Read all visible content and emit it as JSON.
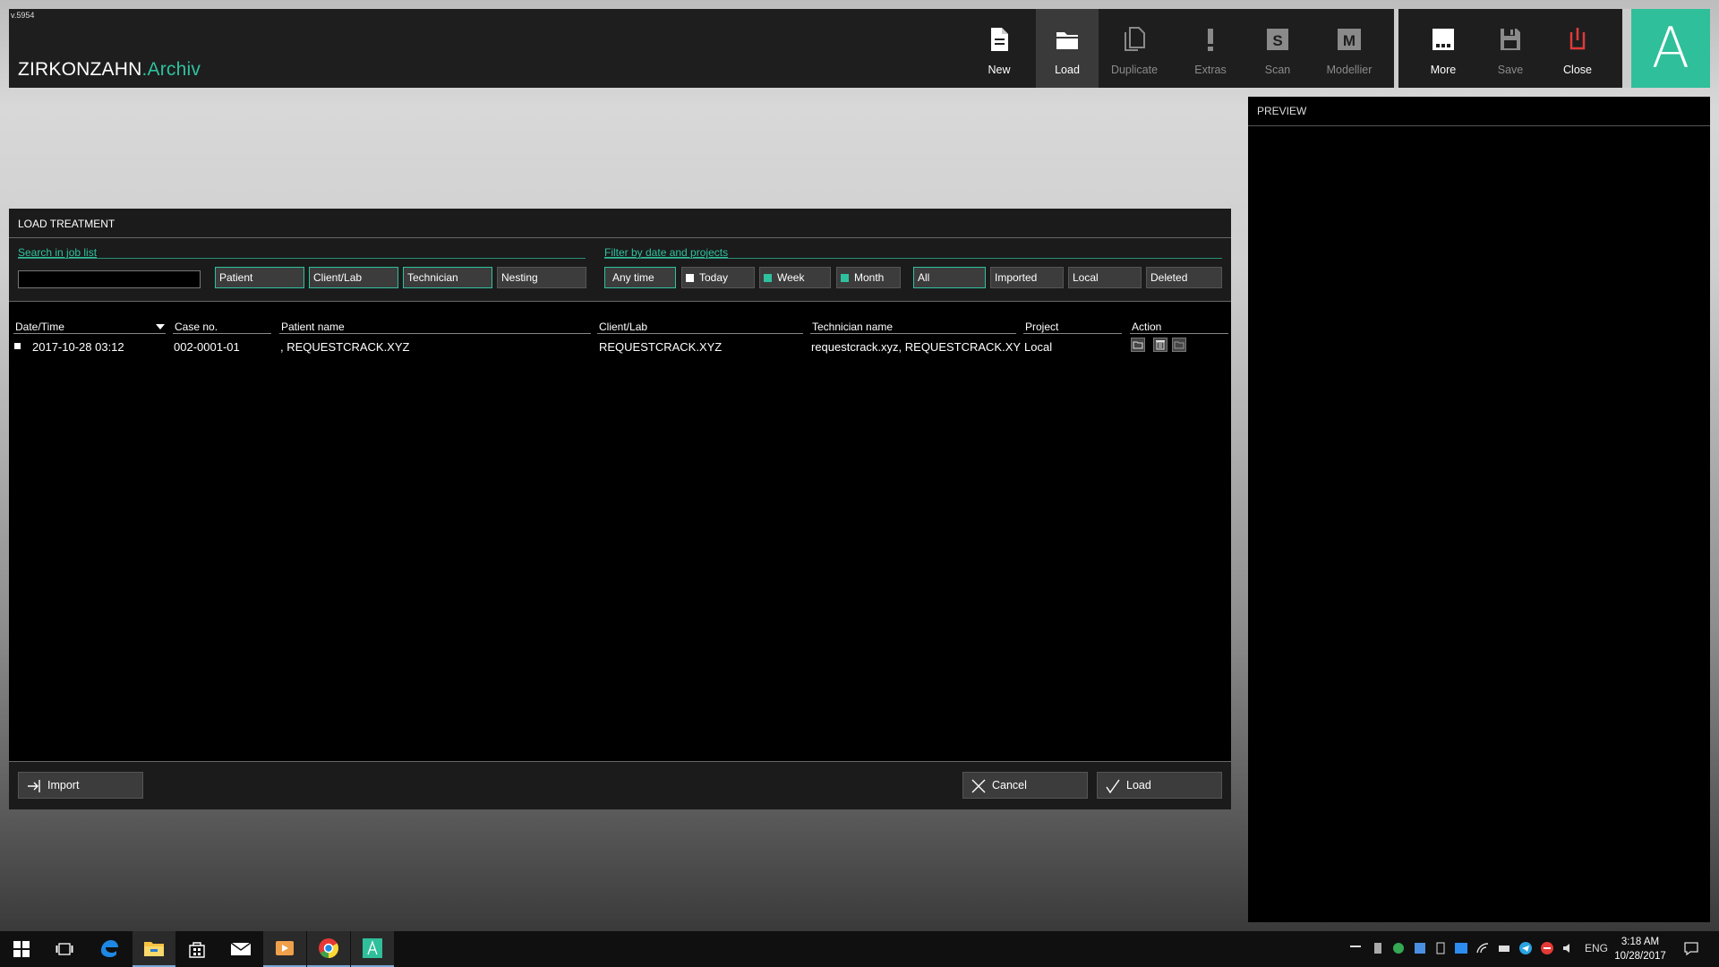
{
  "app": {
    "version": "v.5954",
    "brand_main": "ZIRKONZAHN",
    "brand_accent": ".Archiv",
    "avatar_letter": "A",
    "accent_color": "#2fc19e"
  },
  "toolbar": {
    "new": "New",
    "load": "Load",
    "duplicate": "Duplicate",
    "extras": "Extras",
    "scan": "Scan",
    "modellier": "Modellier",
    "more": "More",
    "save": "Save",
    "close": "Close"
  },
  "preview": {
    "title": "PREVIEW"
  },
  "dialog": {
    "title": "LOAD TREATMENT",
    "search_label": "Search in job list",
    "search_value": "",
    "filter_label": "Filter by date and projects",
    "search_chips": [
      "Patient",
      "Client/Lab",
      "Technician",
      "Nesting"
    ],
    "date_chips": [
      "Any time",
      "Today",
      "Week",
      "Month"
    ],
    "project_chips": [
      "All",
      "Imported",
      "Local",
      "Deleted"
    ],
    "columns": {
      "datetime": "Date/Time",
      "case": "Case no.",
      "patient": "Patient name",
      "client": "Client/Lab",
      "technician": "Technician name",
      "project": "Project",
      "action": "Action"
    },
    "rows": [
      {
        "datetime": "2017-10-28 03:12",
        "case": "002-0001-01",
        "patient": ", REQUESTCRACK.XYZ",
        "client": "REQUESTCRACK.XYZ",
        "technician": "requestcrack.xyz, REQUESTCRACK.XY",
        "project": "Local"
      }
    ],
    "import_label": "Import",
    "cancel_label": "Cancel",
    "load_label": "Load"
  },
  "taskbar": {
    "lang": "ENG",
    "time": "3:18 AM",
    "date": "10/28/2017"
  }
}
